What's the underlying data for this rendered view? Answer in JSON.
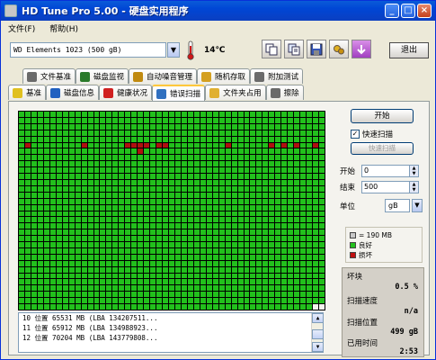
{
  "window": {
    "title": "HD Tune Pro 5.00 - 硬盘实用程序"
  },
  "menu": {
    "file": "文件(F)",
    "help": "帮助(H)"
  },
  "toolbar": {
    "drive": "WD      Elements 1023      (500 gB)",
    "temperature": "14℃",
    "exit_label": "退出",
    "icons": [
      "copy-icon",
      "copy-all-icon",
      "save-icon",
      "settings-icon",
      "download-icon"
    ]
  },
  "tabs_top": [
    {
      "label": "文件基准",
      "icon": "file-benchmark-icon",
      "color": "#6a6a6a"
    },
    {
      "label": "磁盘监视",
      "icon": "disk-monitor-icon",
      "color": "#2a7a2a"
    },
    {
      "label": "自动噪音管理",
      "icon": "speaker-icon",
      "color": "#c08a10"
    },
    {
      "label": "随机存取",
      "icon": "random-access-icon",
      "color": "#d4a020"
    },
    {
      "label": "附加测试",
      "icon": "extra-tests-icon",
      "color": "#6a6a6a"
    }
  ],
  "tabs_bottom": [
    {
      "label": "基准",
      "icon": "bulb-icon",
      "color": "#e0c020"
    },
    {
      "label": "磁盘信息",
      "icon": "info-icon",
      "color": "#2060c0"
    },
    {
      "label": "健康状况",
      "icon": "health-cross-icon",
      "color": "#d02020"
    },
    {
      "label": "错误扫描",
      "icon": "magnifier-icon",
      "color": "#3070c0"
    },
    {
      "label": "文件夹占用",
      "icon": "folder-icon",
      "color": "#e0b030"
    },
    {
      "label": "擦除",
      "icon": "trash-icon",
      "color": "#6a6a6a"
    }
  ],
  "active_tab": "错误扫描",
  "scan": {
    "start_label": "开始",
    "quick_scan_label": "快速扫描",
    "quick_scan_checked": true,
    "quick_scan_btn": "快速扫描",
    "start_field_label": "开始",
    "start_value": "0",
    "end_field_label": "结束",
    "end_value": "500",
    "unit_label": "单位",
    "unit_value": "gB",
    "legend": [
      {
        "label": "= 190 MB",
        "color": "#c8c8c8"
      },
      {
        "label": "良好",
        "color": "#22c01c"
      },
      {
        "label": "损坏",
        "color": "#c01010"
      }
    ],
    "stats": {
      "damaged_label": "坏块",
      "damaged_value": "0.5 %",
      "speed_label": "扫描速度",
      "speed_value": "n/a",
      "position_label": "扫描位置",
      "position_value": "499 gB",
      "elapsed_label": "已用时间",
      "elapsed_value": "2:53"
    },
    "grid": {
      "rows": 32,
      "cols": 49,
      "empty_last_row_cells": 2
    },
    "bad_cells": [
      [
        5,
        1
      ],
      [
        5,
        10
      ],
      [
        5,
        17
      ],
      [
        5,
        18
      ],
      [
        5,
        19
      ],
      [
        5,
        20
      ],
      [
        6,
        19
      ],
      [
        5,
        22
      ],
      [
        5,
        23
      ],
      [
        5,
        33
      ],
      [
        5,
        40
      ],
      [
        5,
        42
      ],
      [
        5,
        44
      ],
      [
        5,
        47
      ]
    ]
  },
  "log": [
    "10      位置 65531 MB  (LBA 134207511...",
    "11      位置 65912 MB  (LBA 134988923...",
    "12      位置 70204 MB  (LBA 143779808..."
  ]
}
